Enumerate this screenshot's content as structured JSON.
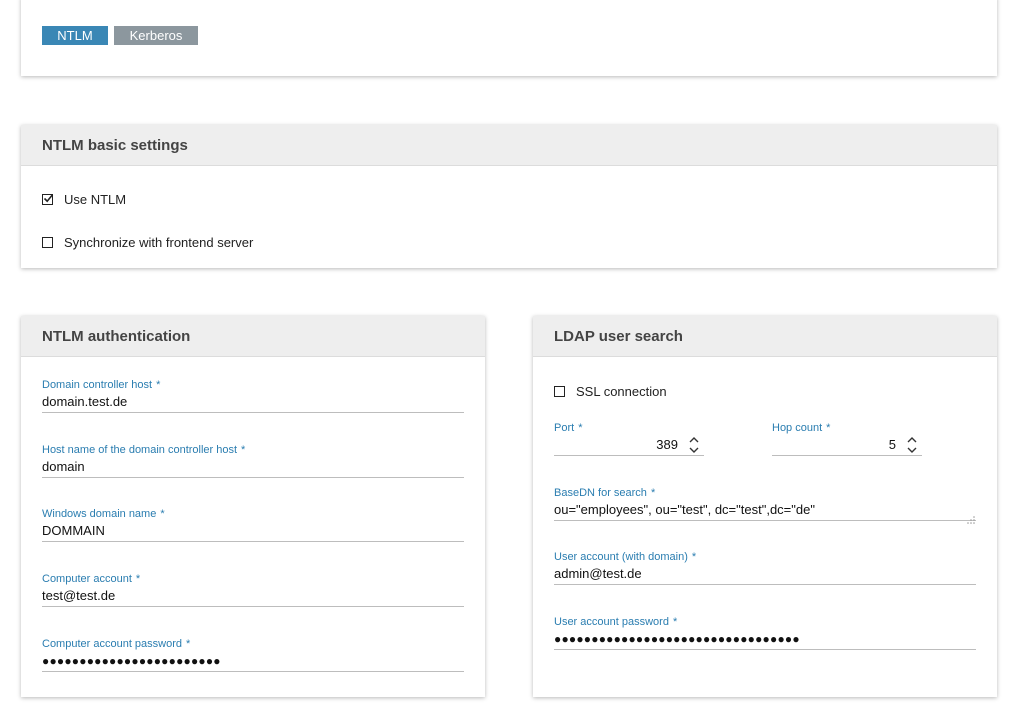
{
  "tabs": [
    {
      "label": "NTLM",
      "active": true
    },
    {
      "label": "Kerberos",
      "active": false
    }
  ],
  "basic_settings": {
    "title": "NTLM basic settings",
    "use_ntlm": {
      "label": "Use NTLM",
      "checked": true
    },
    "sync_frontend": {
      "label": "Synchronize with frontend server",
      "checked": false
    }
  },
  "ntlm_auth": {
    "title": "NTLM authentication",
    "fields": [
      {
        "label": "Domain controller host",
        "value": "domain.test.de"
      },
      {
        "label": "Host name of the domain controller host",
        "value": "domain"
      },
      {
        "label": "Windows domain name",
        "value": "DOMMAIN"
      },
      {
        "label": "Computer account",
        "value": "test@test.de"
      },
      {
        "label": "Computer account password",
        "value": "●●●●●●●●●●●●●●●●●●●●●●●●"
      }
    ]
  },
  "ldap": {
    "title": "LDAP user search",
    "ssl": {
      "label": "SSL connection",
      "checked": false
    },
    "port": {
      "label": "Port",
      "value": "389"
    },
    "hop_count": {
      "label": "Hop count",
      "value": "5"
    },
    "basedn": {
      "label": "BaseDN for search",
      "value": "ou=\"employees\", ou=\"test\", dc=\"test\",dc=\"de\""
    },
    "user_account": {
      "label": "User account (with domain)",
      "value": "admin@test.de"
    },
    "user_password": {
      "label": "User account password",
      "value": "●●●●●●●●●●●●●●●●●●●●●●●●●●●●●●●●●"
    }
  },
  "required_marker": "*",
  "colors": {
    "accent": "#2a7db0",
    "tab_active": "#3a87b5",
    "tab_inactive": "#8c979e",
    "header_bg": "#eeeeee"
  }
}
